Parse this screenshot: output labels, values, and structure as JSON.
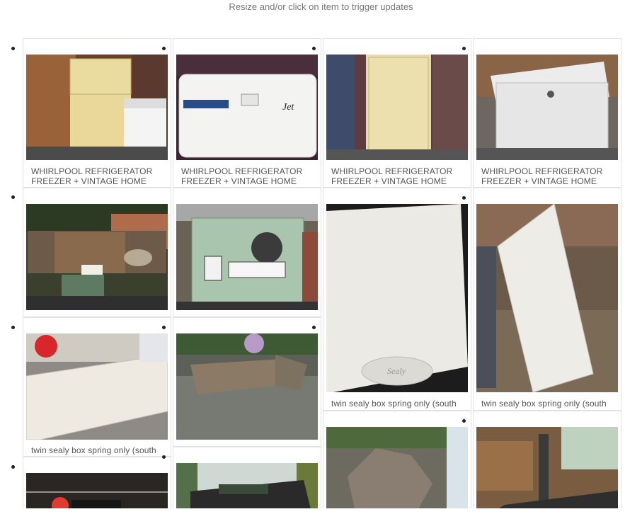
{
  "header": {
    "hint": "Resize and/or click on item to trigger updates"
  },
  "items": [
    {
      "caption": "WHIRLPOOL REFRIGERATOR FREEZER + VINTAGE HOME DEEP",
      "image": "fridge-and-chest-freezer-photo"
    },
    {
      "caption": "WHIRLPOOL REFRIGERATOR FREEZER + VINTAGE HOME DEEP",
      "image": "vintage-chest-freezer-photo"
    },
    {
      "caption": "WHIRLPOOL REFRIGERATOR FREEZER + VINTAGE HOME DEEP",
      "image": "refrigerator-in-shed-photo"
    },
    {
      "caption": "WHIRLPOOL REFRIGERATOR FREEZER + VINTAGE HOME DEEP",
      "image": "chest-freezer-back-photo"
    },
    {
      "caption": "",
      "image": "table-saw-free-photo"
    },
    {
      "caption": "",
      "image": "jet-table-saw-photo"
    },
    {
      "caption": "twin sealy box spring only (south",
      "image": "sealy-box-spring-closeup-photo"
    },
    {
      "caption": "twin sealy box spring only (south",
      "image": "box-spring-leaning-photo"
    },
    {
      "caption": "twin sealy box spring only (south",
      "image": "box-spring-edge-photo"
    },
    {
      "caption": "",
      "image": "stone-fire-pit-photo"
    },
    {
      "caption": "",
      "image": "rock-pile-photo"
    },
    {
      "caption": "",
      "image": "treadmill-garage-photo"
    },
    {
      "caption": "",
      "image": "table-top-photo"
    },
    {
      "caption": "",
      "image": "treadmill-console-photo"
    }
  ]
}
